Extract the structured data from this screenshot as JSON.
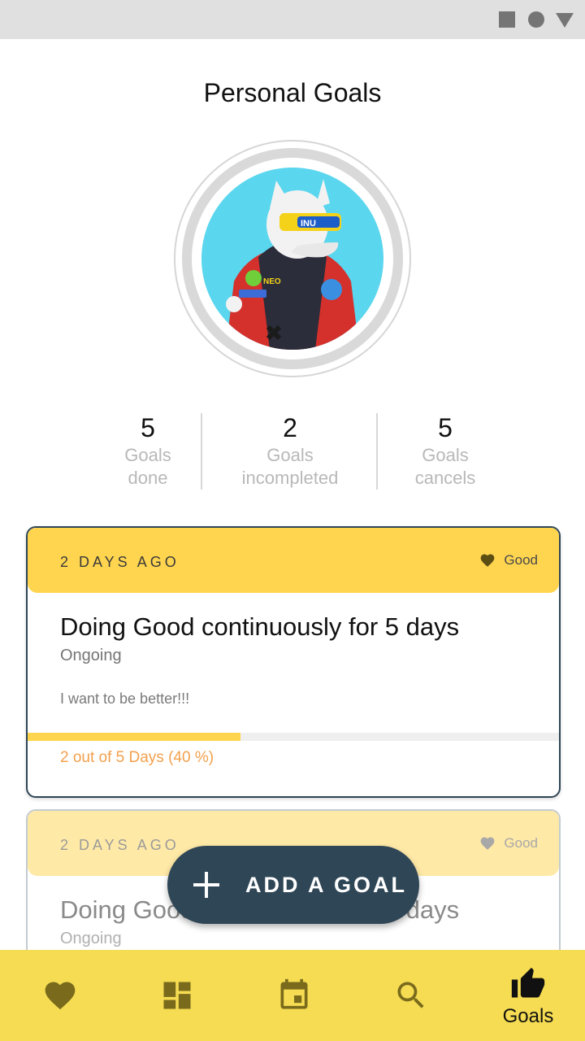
{
  "page": {
    "title": "Personal Goals"
  },
  "avatar": {
    "name": "avatar-image",
    "jacket_text_1": "NEO",
    "jacket_text_2": "INU"
  },
  "stats": [
    {
      "value": "5",
      "label_line1": "Goals",
      "label_line2": "done"
    },
    {
      "value": "2",
      "label_line1": "Goals",
      "label_line2": "incompleted"
    },
    {
      "value": "5",
      "label_line1": "Goals",
      "label_line2": "cancels"
    }
  ],
  "goals": [
    {
      "date": "2 DAYS AGO",
      "tag": "Good",
      "title": "Doing Good continuously for 5 days",
      "status": "Ongoing",
      "description": "I want to be better!!!",
      "progress_text": "2 out of 5 Days (40 %)",
      "progress_fraction": 0.4
    },
    {
      "date": "2 DAYS AGO",
      "tag": "Good",
      "title": "Doing Good continuously for 5 days",
      "status": "Ongoing"
    }
  ],
  "fab": {
    "label": "ADD A GOAL",
    "icon": "plus-icon"
  },
  "bottom_nav": {
    "items": [
      {
        "icon": "heart-icon"
      },
      {
        "icon": "dashboard-icon"
      },
      {
        "icon": "calendar-icon"
      },
      {
        "icon": "search-icon"
      },
      {
        "icon": "thumb-up-icon",
        "label": "Goals",
        "active": true
      }
    ]
  },
  "colors": {
    "accent_yellow": "#ffd54f",
    "nav_yellow": "#f5dc52",
    "navy": "#2f4656",
    "progress_text": "#f3a04d"
  }
}
